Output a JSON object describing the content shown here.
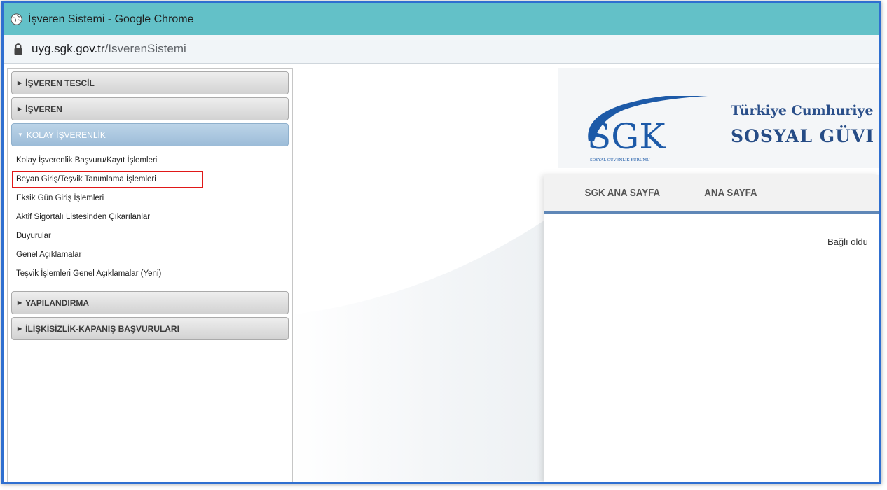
{
  "window": {
    "title": "İşveren Sistemi - Google Chrome",
    "icon": "globe-icon"
  },
  "address": {
    "domain": "uyg.sgk.gov.tr",
    "path": "/IsverenSistemi",
    "icon": "lock-icon"
  },
  "sidebar": {
    "sections": [
      {
        "label": "İŞVEREN TESCİL"
      },
      {
        "label": "İŞVEREN"
      },
      {
        "label": "KOLAY İŞVERENLİK"
      },
      {
        "label": "YAPILANDIRMA"
      },
      {
        "label": "İLİŞKİSİZLİK-KAPANIŞ BAŞVURULARI"
      }
    ],
    "items": [
      {
        "label": "Kolay İşverenlik Başvuru/Kayıt İşlemleri"
      },
      {
        "label": "Beyan Giriş/Teşvik Tanımlama İşlemleri"
      },
      {
        "label": "Eksik Gün Giriş İşlemleri"
      },
      {
        "label": "Aktif Sigortalı Listesinden Çıkarılanlar"
      },
      {
        "label": "Duyurular"
      },
      {
        "label": "Genel Açıklamalar"
      },
      {
        "label": "Teşvik İşlemleri Genel Açıklamalar (Yeni)"
      }
    ]
  },
  "banner": {
    "logo_text": "SGK",
    "logo_subtext": "SOSYAL GÜVENLİK KURUMU",
    "line1": "Türkiye Cumhuriye",
    "line2": "SOSYAL GÜVI"
  },
  "nav": {
    "links": [
      {
        "label": "SGK ANA SAYFA"
      },
      {
        "label": "ANA SAYFA"
      }
    ]
  },
  "content": {
    "text": "Bağlı oldu"
  },
  "colors": {
    "titlebar": "#63c1c8",
    "highlight": "#e01818",
    "nav_accent": "#5f87b7",
    "brand_blue": "#264c86"
  }
}
